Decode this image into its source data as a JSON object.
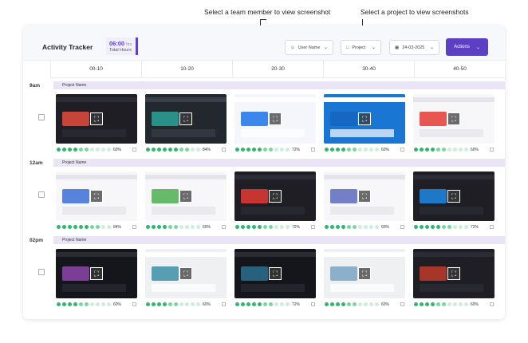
{
  "callouts": {
    "team_member": "Select a team member to view screenshot",
    "project": "Select a project to view screenshots"
  },
  "header": {
    "title": "Activity Tracker",
    "hours_value": "06:00",
    "hours_unit": "hrs",
    "hours_label": "Total Hours",
    "user_select": "User Name",
    "project_select": "Project",
    "date_select": "24-03-2025",
    "actions_label": "Actions"
  },
  "columns": [
    "00-10",
    "10-20",
    "20-30",
    "30-40",
    "40-50"
  ],
  "rows": [
    {
      "time": "9am",
      "project": "Project Name",
      "cells": [
        {
          "pct": "60%",
          "theme": "dark",
          "accent": "#e84b3c"
        },
        {
          "pct": "84%",
          "theme": "code",
          "accent": "#2aa39a"
        },
        {
          "pct": "72%",
          "theme": "social",
          "accent": "#1a73e8"
        },
        {
          "pct": "60%",
          "theme": "blue",
          "accent": "#1565c0"
        },
        {
          "pct": "60%",
          "theme": "light",
          "accent": "#e53935"
        }
      ]
    },
    {
      "time": "12am",
      "project": "Project Name",
      "cells": [
        {
          "pct": "84%",
          "theme": "light",
          "accent": "#3b6fd8"
        },
        {
          "pct": "60%",
          "theme": "light",
          "accent": "#4caf50"
        },
        {
          "pct": "72%",
          "theme": "dark",
          "accent": "#e53935"
        },
        {
          "pct": "60%",
          "theme": "light",
          "accent": "#5c6bc0"
        },
        {
          "pct": "72%",
          "theme": "dark",
          "accent": "#1e88e5"
        }
      ]
    },
    {
      "time": "02pm",
      "project": "Project Name",
      "cells": [
        {
          "pct": "60%",
          "theme": "video",
          "accent": "#8e44ad"
        },
        {
          "pct": "60%",
          "theme": "photo",
          "accent": "#3d8fa8"
        },
        {
          "pct": "72%",
          "theme": "video",
          "accent": "#2c6e8f"
        },
        {
          "pct": "60%",
          "theme": "photo",
          "accent": "#7aa5c4"
        },
        {
          "pct": "60%",
          "theme": "dark",
          "accent": "#c0392b"
        }
      ]
    }
  ],
  "colors": {
    "accent": "#5b3fc4",
    "activity_on": "#2eb86b",
    "project_band": "#e9e5f6"
  }
}
